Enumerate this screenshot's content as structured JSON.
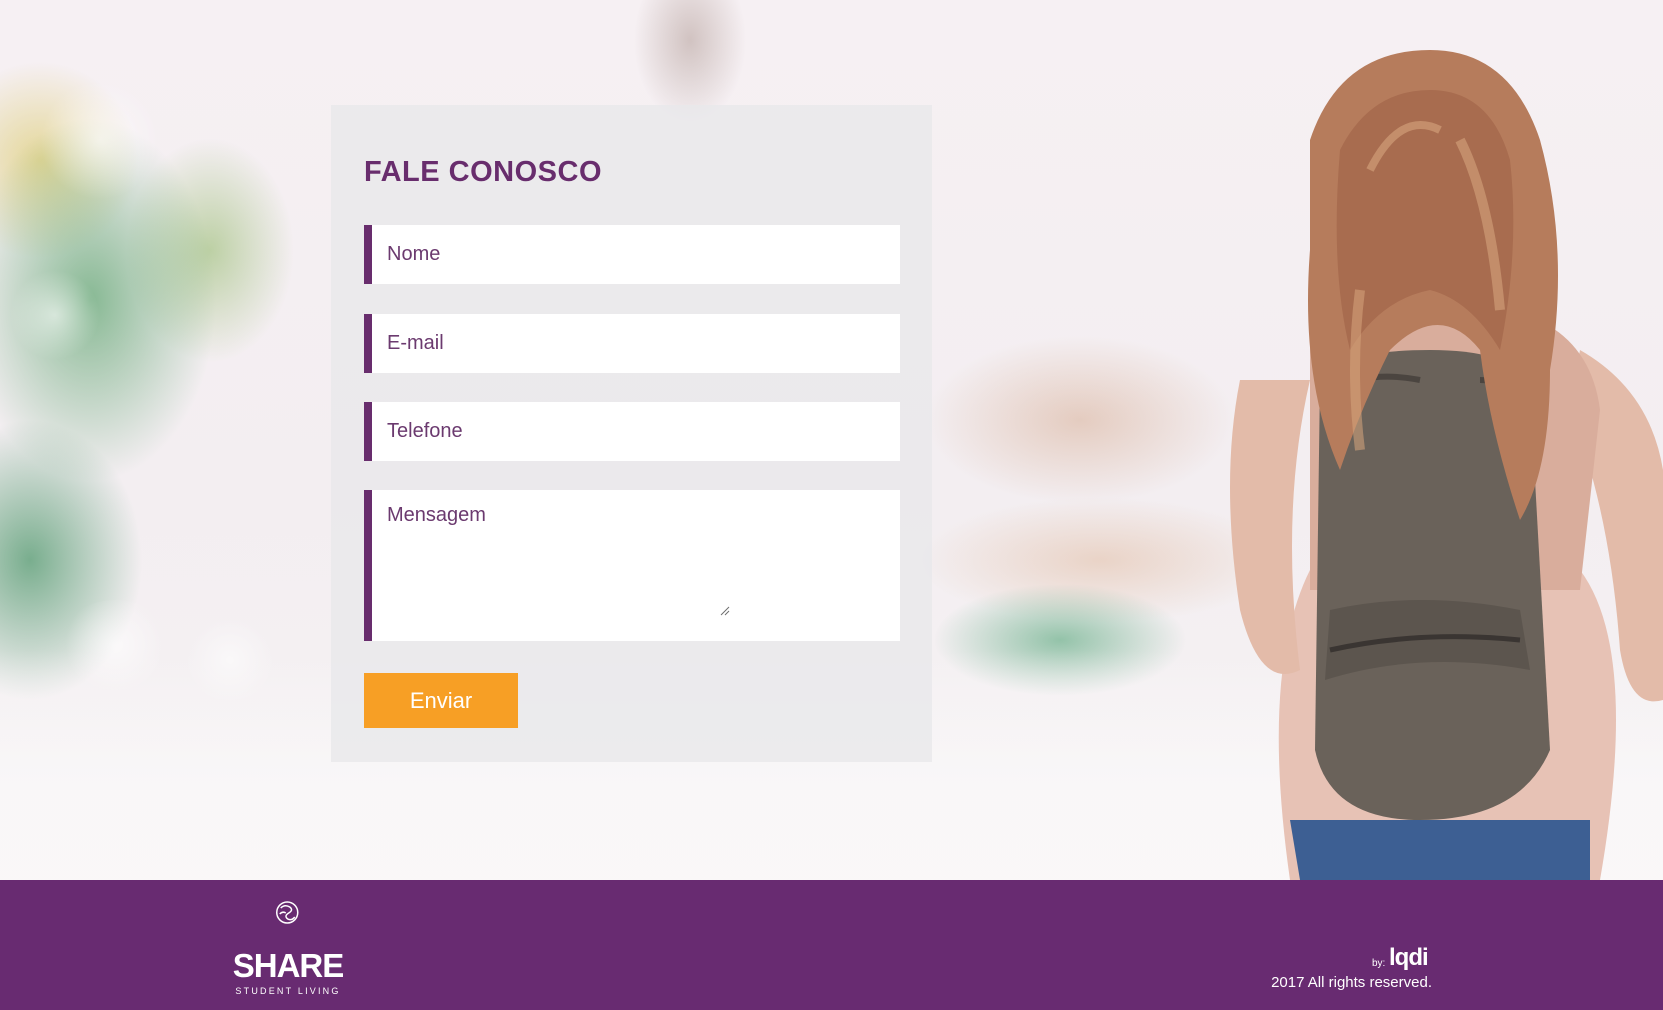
{
  "contact_form": {
    "title": "FALE CONOSCO",
    "name_placeholder": "Nome",
    "email_placeholder": "E-mail",
    "phone_placeholder": "Telefone",
    "message_placeholder": "Mensagem",
    "submit_label": "Enviar"
  },
  "footer": {
    "logo_text": "SHARE",
    "logo_tagline": "STUDENT LIVING",
    "credit_prefix": "by:",
    "credit_brand": "lqdi",
    "copyright": "2017 All rights reserved."
  },
  "colors": {
    "brand_purple": "#682d6d",
    "footer_purple": "#682b71",
    "button_orange": "#f79f25"
  },
  "icons": {
    "logo_mark": "share-logo-icon",
    "textarea_resize": "resize-grip-icon"
  }
}
